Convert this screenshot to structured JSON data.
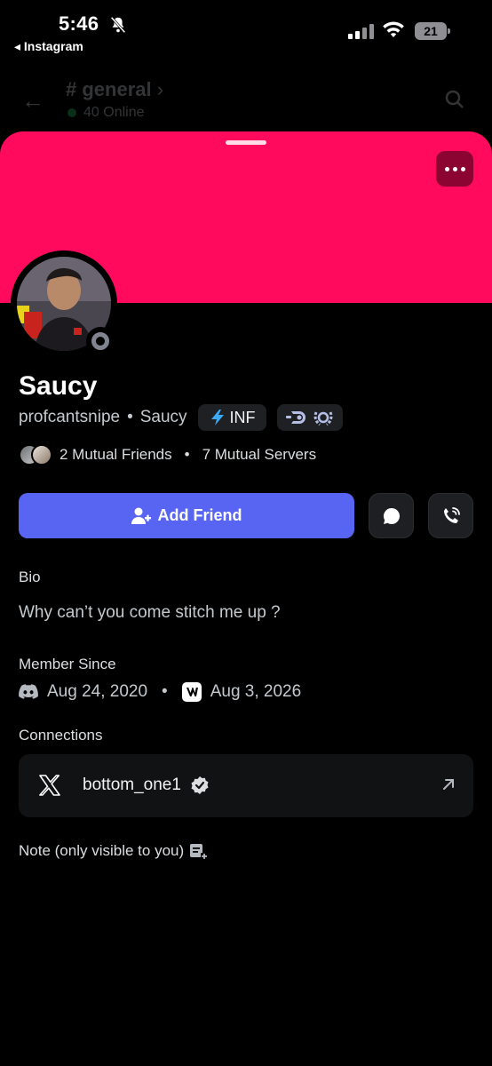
{
  "status_bar": {
    "time": "5:46",
    "back_app_label": "◂ Instagram",
    "battery": "21",
    "icons": [
      "bell-slash-icon",
      "signal-icon",
      "wifi-icon",
      "battery-icon"
    ]
  },
  "channel": {
    "name": "# general",
    "online": "40 Online"
  },
  "profile": {
    "banner_color": "#ff0a5c",
    "display_name": "Saucy",
    "username": "profcantsnipe",
    "separator": "•",
    "pronoun_name": "Saucy",
    "guild_tag": "INF",
    "mutual_friends": "2 Mutual Friends",
    "mutual_servers": "7 Mutual Servers",
    "status": "offline"
  },
  "actions": {
    "add_friend_label": "Add Friend",
    "accent": "#5865f2"
  },
  "bio": {
    "label": "Bio",
    "text": "Why can’t you come stitch me up ?"
  },
  "member_since": {
    "label": "Member Since",
    "discord_date": "Aug 24, 2020",
    "server_date": "Aug 3, 2026"
  },
  "connections": {
    "label": "Connections",
    "items": [
      {
        "platform": "X",
        "name": "bottom_one1",
        "verified": true
      }
    ]
  },
  "note": {
    "label": "Note (only visible to you)"
  }
}
